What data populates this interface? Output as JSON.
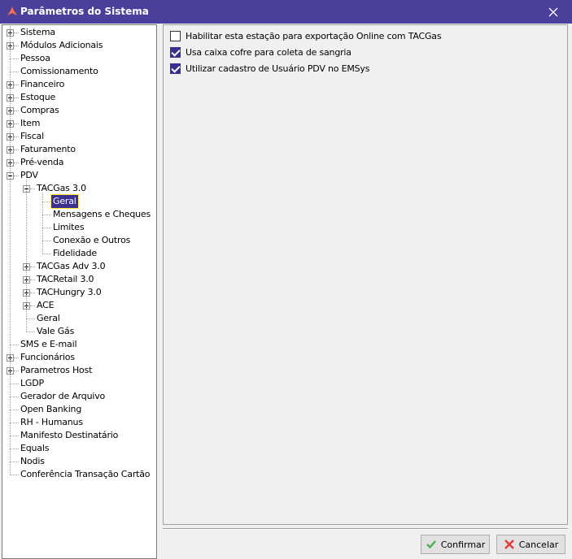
{
  "window": {
    "title": "Parâmetros do Sistema",
    "close_glyph": "✕"
  },
  "tree": [
    {
      "label": "Sistema",
      "level": 0,
      "expander": "plus"
    },
    {
      "label": "Módulos Adicionais",
      "level": 0,
      "expander": "plus"
    },
    {
      "label": "Pessoa",
      "level": 0,
      "expander": "none"
    },
    {
      "label": "Comissionamento",
      "level": 0,
      "expander": "none"
    },
    {
      "label": "Financeiro",
      "level": 0,
      "expander": "plus"
    },
    {
      "label": "Estoque",
      "level": 0,
      "expander": "plus"
    },
    {
      "label": "Compras",
      "level": 0,
      "expander": "plus"
    },
    {
      "label": "Item",
      "level": 0,
      "expander": "plus"
    },
    {
      "label": "Fiscal",
      "level": 0,
      "expander": "plus"
    },
    {
      "label": "Faturamento",
      "level": 0,
      "expander": "plus"
    },
    {
      "label": "Pré-venda",
      "level": 0,
      "expander": "plus"
    },
    {
      "label": "PDV",
      "level": 0,
      "expander": "minus"
    },
    {
      "label": "TACGas 3.0",
      "level": 1,
      "expander": "minus"
    },
    {
      "label": "Geral",
      "level": 2,
      "expander": "none",
      "selected": true
    },
    {
      "label": "Mensagens e Cheques",
      "level": 2,
      "expander": "none"
    },
    {
      "label": "Limites",
      "level": 2,
      "expander": "none"
    },
    {
      "label": "Conexão e Outros",
      "level": 2,
      "expander": "none"
    },
    {
      "label": "Fidelidade",
      "level": 2,
      "expander": "none"
    },
    {
      "label": "TACGas Adv 3.0",
      "level": 1,
      "expander": "plus"
    },
    {
      "label": "TACRetail 3.0",
      "level": 1,
      "expander": "plus"
    },
    {
      "label": "TACHungry 3.0",
      "level": 1,
      "expander": "plus"
    },
    {
      "label": "ACE",
      "level": 1,
      "expander": "plus"
    },
    {
      "label": "Geral",
      "level": 1,
      "expander": "none"
    },
    {
      "label": "Vale Gás",
      "level": 1,
      "expander": "none"
    },
    {
      "label": "SMS e E-mail",
      "level": 0,
      "expander": "none"
    },
    {
      "label": "Funcionários",
      "level": 0,
      "expander": "plus"
    },
    {
      "label": "Parametros Host",
      "level": 0,
      "expander": "plus"
    },
    {
      "label": "LGDP",
      "level": 0,
      "expander": "none"
    },
    {
      "label": "Gerador de Arquivo",
      "level": 0,
      "expander": "none"
    },
    {
      "label": "Open Banking",
      "level": 0,
      "expander": "none"
    },
    {
      "label": "RH - Humanus",
      "level": 0,
      "expander": "none"
    },
    {
      "label": "Manifesto Destinatário",
      "level": 0,
      "expander": "none"
    },
    {
      "label": "Equals",
      "level": 0,
      "expander": "none"
    },
    {
      "label": "Nodis",
      "level": 0,
      "expander": "none"
    },
    {
      "label": "Conferência Transação Cartão",
      "level": 0,
      "expander": "none"
    }
  ],
  "options": [
    {
      "label": "Habilitar esta estação para exportação Online com TACGas",
      "checked": false
    },
    {
      "label": "Usa caixa cofre para coleta de sangria",
      "checked": true
    },
    {
      "label": "Utilizar cadastro de Usuário PDV no EMSys",
      "checked": true
    }
  ],
  "buttons": {
    "confirm_label": "Confirmar",
    "cancel_label": "Cancelar"
  },
  "colors": {
    "titlebar": "#4a3f9a",
    "selection": "#3b2f8f",
    "confirm_icon": "#4caf50",
    "cancel_icon": "#e53935"
  }
}
